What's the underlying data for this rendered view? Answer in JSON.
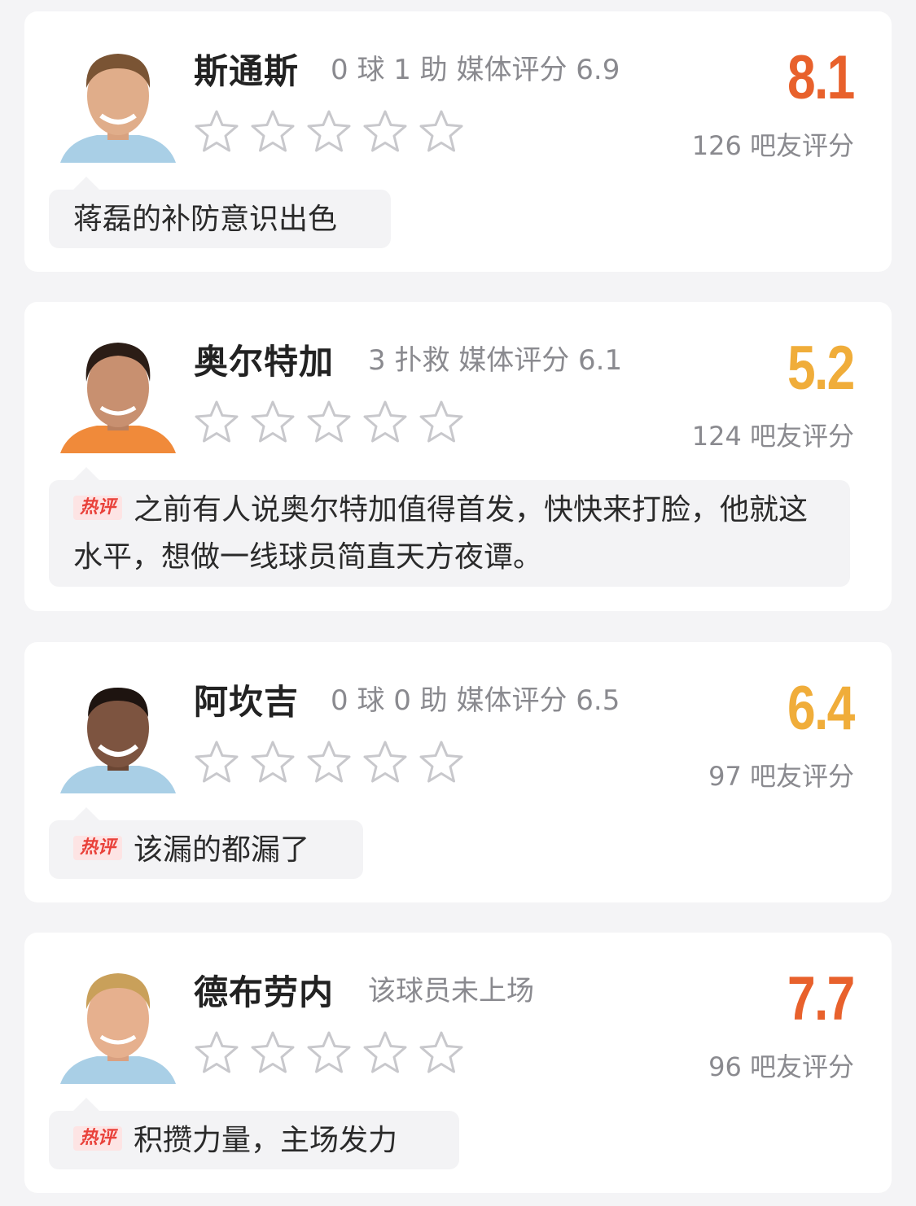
{
  "colors": {
    "score_high": "#e8612c",
    "score_mid": "#f0ad3a",
    "hot_tag_text": "#e9413a",
    "hot_tag_bg": "#fde4e4",
    "star_outline": "#c8c8cc"
  },
  "players": [
    {
      "name": "斯通斯",
      "stats": "0 球  1 助   媒体评分 6.9",
      "score": "8.1",
      "score_color": "#e8612c",
      "fan_count": "126 吧友评分",
      "comment": {
        "hot_tag": "",
        "text": "蒋磊的补防意识出色"
      },
      "stars_filled": 0,
      "star_icon": "star-outline-icon",
      "jersey": "#a9cfe6"
    },
    {
      "name": "奥尔特加",
      "stats": "3 扑救   媒体评分 6.1",
      "score": "5.2",
      "score_color": "#f0ad3a",
      "fan_count": "124 吧友评分",
      "comment": {
        "hot_tag": "热评",
        "text": "之前有人说奥尔特加值得首发，快快来打脸，他就这水平，想做一线球员简直天方夜谭。"
      },
      "stars_filled": 0,
      "star_icon": "star-outline-icon",
      "jersey": "#f08a3a"
    },
    {
      "name": "阿坎吉",
      "stats": "0 球  0 助   媒体评分 6.5",
      "score": "6.4",
      "score_color": "#f0ad3a",
      "fan_count": "97 吧友评分",
      "comment": {
        "hot_tag": "热评",
        "text": "该漏的都漏了"
      },
      "stars_filled": 0,
      "star_icon": "star-outline-icon",
      "jersey": "#a9cfe6"
    },
    {
      "name": "德布劳内",
      "stats": "该球员未上场",
      "score": "7.7",
      "score_color": "#e8612c",
      "fan_count": "96 吧友评分",
      "comment": {
        "hot_tag": "热评",
        "text": "积攒力量，主场发力"
      },
      "stars_filled": 0,
      "star_icon": "star-outline-icon",
      "jersey": "#a9cfe6"
    }
  ]
}
